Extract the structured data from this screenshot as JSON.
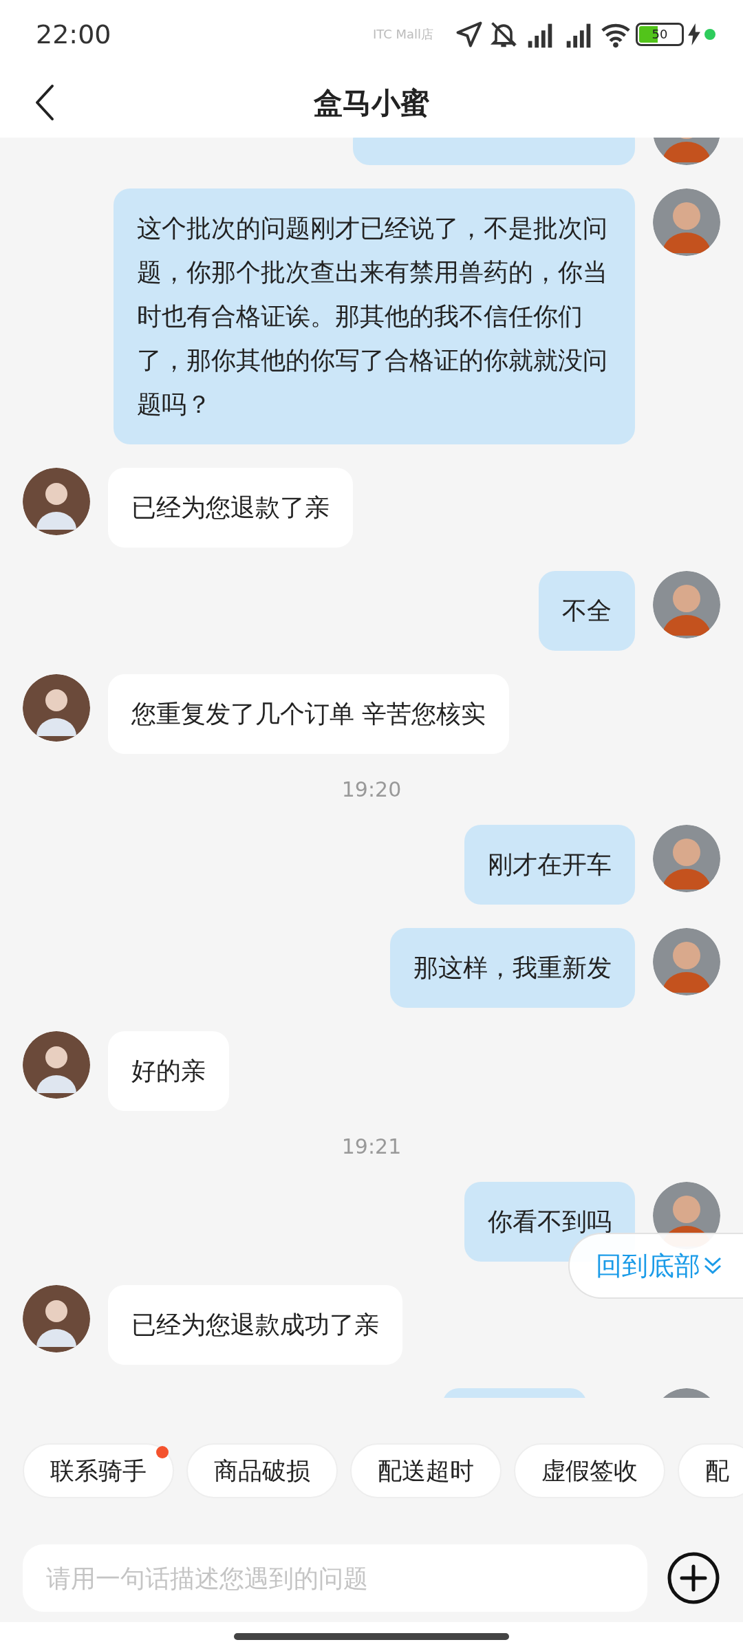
{
  "status_bar": {
    "time": "22:00",
    "carrier_label": "ITC Mall店",
    "battery": "50"
  },
  "header": {
    "title": "盒马小蜜"
  },
  "messages": [
    {
      "kind": "sent_cut"
    },
    {
      "kind": "sent",
      "text": "这个批次的问题刚才已经说了，不是批次问题，你那个批次查出来有禁用兽药的，你当时也有合格证诶。那其他的我不信任你们了，那你其他的你写了合格证的你就就没问题吗？"
    },
    {
      "kind": "received",
      "text": "已经为您退款了亲"
    },
    {
      "kind": "sent",
      "text": "不全"
    },
    {
      "kind": "received",
      "text": "您重复发了几个订单 辛苦您核实"
    },
    {
      "kind": "time",
      "text": "19:20"
    },
    {
      "kind": "sent",
      "text": "刚才在开车"
    },
    {
      "kind": "sent",
      "text": "那这样，我重新发"
    },
    {
      "kind": "received",
      "text": "好的亲"
    },
    {
      "kind": "time",
      "text": "19:21"
    },
    {
      "kind": "sent",
      "text": "你看不到吗"
    },
    {
      "kind": "received",
      "text": "已经为您退款成功了亲"
    },
    {
      "kind": "sent_cut"
    }
  ],
  "scroll_button": {
    "label": "回到底部"
  },
  "quick_replies": [
    {
      "label": "联系骑手",
      "badge": true
    },
    {
      "label": "商品破损",
      "badge": false
    },
    {
      "label": "配送超时",
      "badge": false
    },
    {
      "label": "虚假签收",
      "badge": false
    },
    {
      "label": "配",
      "badge": false
    }
  ],
  "input": {
    "placeholder": "请用一句话描述您遇到的问题"
  }
}
